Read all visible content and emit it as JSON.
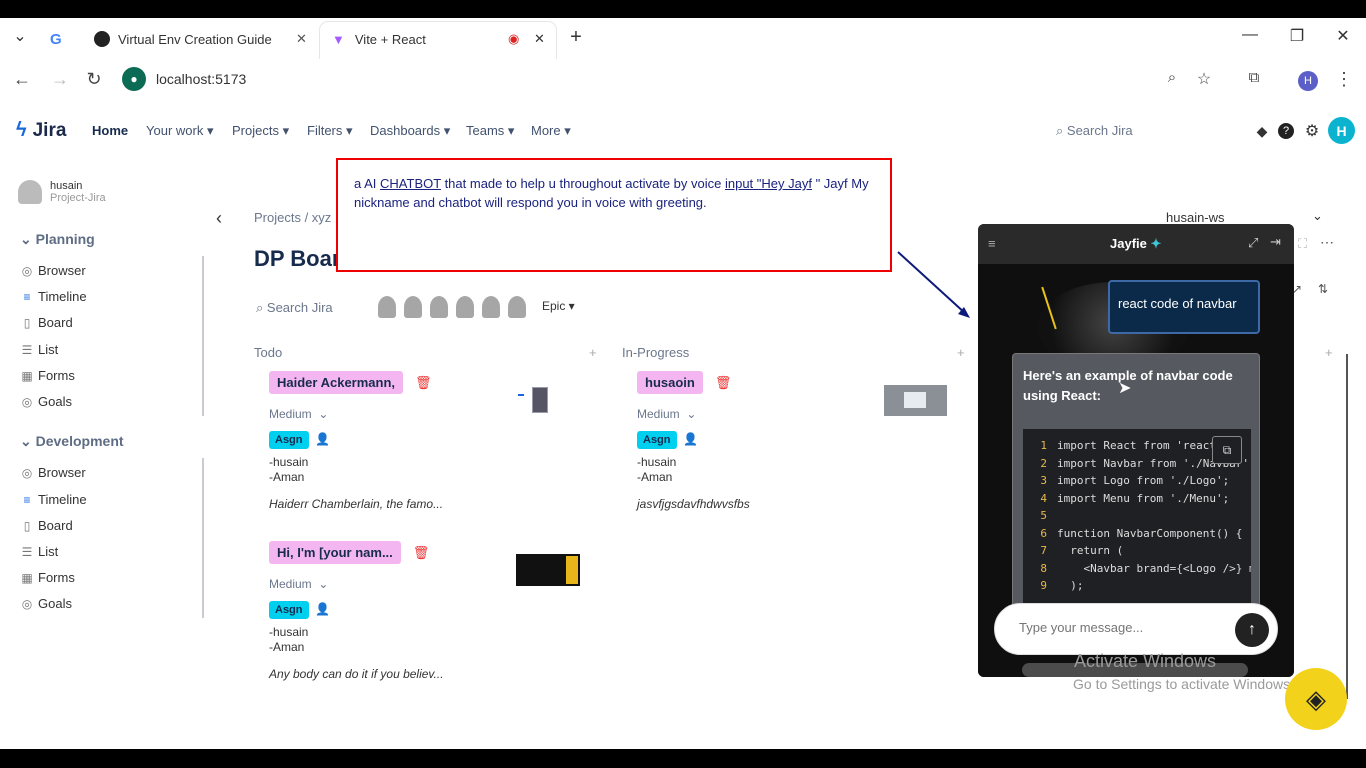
{
  "browser": {
    "tabs": [
      {
        "label": "Virtual Env Creation Guide"
      },
      {
        "label": "Vite + React"
      }
    ],
    "url": "localhost:5173",
    "profile_initial": "H"
  },
  "jira": {
    "logo_text": "Jira",
    "menu": [
      "Home",
      "Your work",
      "Projects",
      "Filters",
      "Dashboards",
      "Teams",
      "More"
    ],
    "search_placeholder": "Search Jira",
    "avatar_initial": "H"
  },
  "sidebar": {
    "user_name": "husain",
    "user_project": "Project-Jira",
    "sections": [
      {
        "title": "Planning",
        "items": [
          "Browser",
          "Timeline",
          "Board",
          "List",
          "Forms",
          "Goals"
        ]
      },
      {
        "title": "Development",
        "items": [
          "Browser",
          "Timeline",
          "Board",
          "List",
          "Forms",
          "Goals"
        ]
      }
    ]
  },
  "board": {
    "breadcrumb": "Projects / xyz",
    "title": "DP Board",
    "search_placeholder": "Search Jira",
    "epic_label": "Epic",
    "workspace": "husain-ws",
    "columns": [
      {
        "title": "Todo"
      },
      {
        "title": "In-Progress"
      }
    ],
    "cards": [
      {
        "name": "Haider Ackermann,",
        "priority": "Medium",
        "badge": "Asgn",
        "assignee1": "-husain",
        "assignee2": "-Aman",
        "desc": "Haiderr Chamberlain, the famo..."
      },
      {
        "name": "Hi, I'm [your nam...",
        "priority": "Medium",
        "badge": "Asgn",
        "assignee1": "-husain",
        "assignee2": "-Aman",
        "desc": "Any body can do it if you believ..."
      },
      {
        "name": "husaoin",
        "priority": "Medium",
        "badge": "Asgn",
        "assignee1": "-husain",
        "assignee2": "-Aman",
        "desc": "jasvfjgsdavfhdwvsfbs"
      }
    ]
  },
  "annotation": {
    "p1": "a AI ",
    "chatbot_word": "CHATBOT",
    "p2": " that made to help u throughout activate by voice ",
    "input_word": "input \"Hey Jayf",
    "p3": " \" Jayf My nickname and chatbot will respond you in voice with greeting.",
    "color": "#e00000"
  },
  "chat": {
    "title": "Jayfie",
    "user_message": "react code of navbar",
    "reply_text": "Here's an example of navbar code using React:",
    "code_lines": [
      "import React from 'react';",
      "import Navbar from './Navbar';",
      "import Logo from './Logo';",
      "import Menu from './Menu';",
      "",
      "function NavbarComponent() {",
      "  return (",
      "    <Navbar brand={<Logo />} m",
      "  );"
    ],
    "input_placeholder": "Type your message..."
  },
  "watermark": {
    "line1": "Activate Windows",
    "line2": "Go to Settings to activate Windows"
  }
}
